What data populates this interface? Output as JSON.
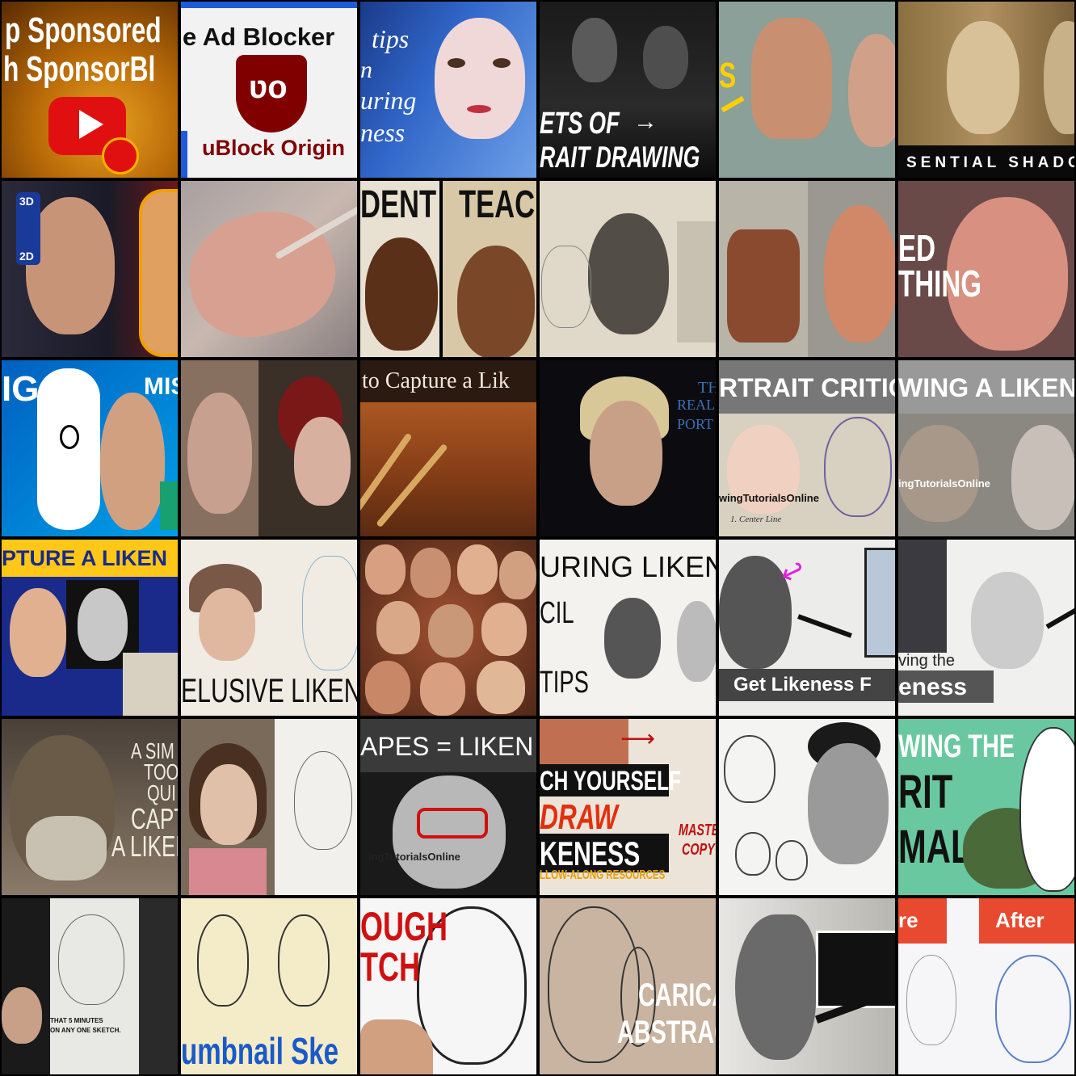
{
  "grid": {
    "tiles": [
      {
        "lines": [
          "p Sponsored",
          "h SponsorBl"
        ]
      },
      {
        "lines": [
          "e Ad Blocker",
          "uBlock Origin"
        ]
      },
      {
        "lines": [
          "tips",
          "n",
          "uring",
          "ness"
        ]
      },
      {
        "lines": [
          "ETS OF",
          "RAIT DRAWING"
        ]
      },
      {
        "lines": [
          "S"
        ]
      },
      {
        "lines": [
          "SENTIAL SHADO"
        ]
      },
      {
        "lines": [
          "3D",
          "2D"
        ]
      },
      {
        "lines": []
      },
      {
        "lines": [
          "DENT",
          "TEACH"
        ]
      },
      {
        "lines": []
      },
      {
        "lines": []
      },
      {
        "lines": [
          "ED",
          "THING"
        ]
      },
      {
        "lines": [
          "IG",
          "MIS"
        ]
      },
      {
        "lines": []
      },
      {
        "lines": [
          "to Capture a Lik"
        ]
      },
      {
        "lines": [
          "TH",
          "REAL",
          "PORT"
        ]
      },
      {
        "lines": [
          "RTRAIT CRITIC",
          "wingTutorialsOnline",
          "1. Center Line"
        ]
      },
      {
        "lines": [
          "WING A LIKEN",
          "ingTutorialsOnline"
        ]
      },
      {
        "lines": [
          "PTURE A LIKEN"
        ]
      },
      {
        "lines": [
          "ELUSIVE LIKENESS"
        ]
      },
      {
        "lines": []
      },
      {
        "lines": [
          "URING LIKENESS",
          "CIL",
          "TIPS"
        ]
      },
      {
        "lines": [
          "Get Likeness F"
        ]
      },
      {
        "lines": [
          "ving the",
          "eness"
        ]
      },
      {
        "lines": [
          "A SIM",
          "TOO",
          "QUI",
          "CAPT",
          "A LIKEN"
        ]
      },
      {
        "lines": []
      },
      {
        "lines": [
          "APES = LIKEN",
          "ingTutorialsOnline"
        ]
      },
      {
        "lines": [
          "CH YOURSELF",
          "DRAW",
          "KENESS",
          "LLOW-ALONG RESOURCES",
          "MASTE",
          "COPY"
        ]
      },
      {
        "lines": []
      },
      {
        "lines": [
          "WING THE",
          "RIT",
          "MAL"
        ]
      },
      {
        "lines": [
          "THAT 5 MINUTES",
          "ON ANY ONE SKETCH."
        ]
      },
      {
        "lines": [
          "umbnail Ske"
        ]
      },
      {
        "lines": [
          "OUGH",
          "TCH"
        ]
      },
      {
        "lines": [
          "CARICA",
          "ABSTRAC"
        ]
      },
      {
        "lines": []
      },
      {
        "lines": [
          "re",
          "After"
        ]
      }
    ]
  }
}
